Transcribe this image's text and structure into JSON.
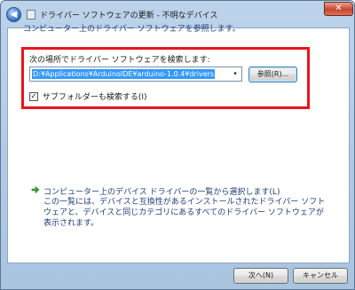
{
  "window": {
    "title": "ドライバー ソフトウェアの更新 - 不明なデバイス",
    "back_glyph": "◀",
    "close_glyph": "✕"
  },
  "intro": "コンピューター上のドライバー ソフトウェアを参照します。",
  "search": {
    "label": "次の場所でドライバー ソフトウェアを検索します:",
    "path_value": "D:¥Applications¥ArduinoIDE¥arduino-1.0.4¥drivers",
    "combo_arrow": "▾",
    "browse_label": "参照(R)...",
    "include_subfolders_label": "サブフォルダーも検索する(I)",
    "include_subfolders_checked": true,
    "check_glyph": "✓"
  },
  "pick_option": {
    "title": "コンピューター上のデバイス ドライバーの一覧から選択します(L)",
    "description": "この一覧には、デバイスと互換性があるインストールされたドライバー ソフトウェアと、デバイスと同じカテゴリにあるすべてのドライバー ソフトウェアが表示されます。",
    "icon": "green-arrow-icon"
  },
  "footer": {
    "next_label": "次へ(N)",
    "cancel_label": "キャンセル"
  },
  "colors": {
    "highlight_border": "#e8141e",
    "selection": "#3399ff",
    "link_text": "#1e3e73"
  }
}
